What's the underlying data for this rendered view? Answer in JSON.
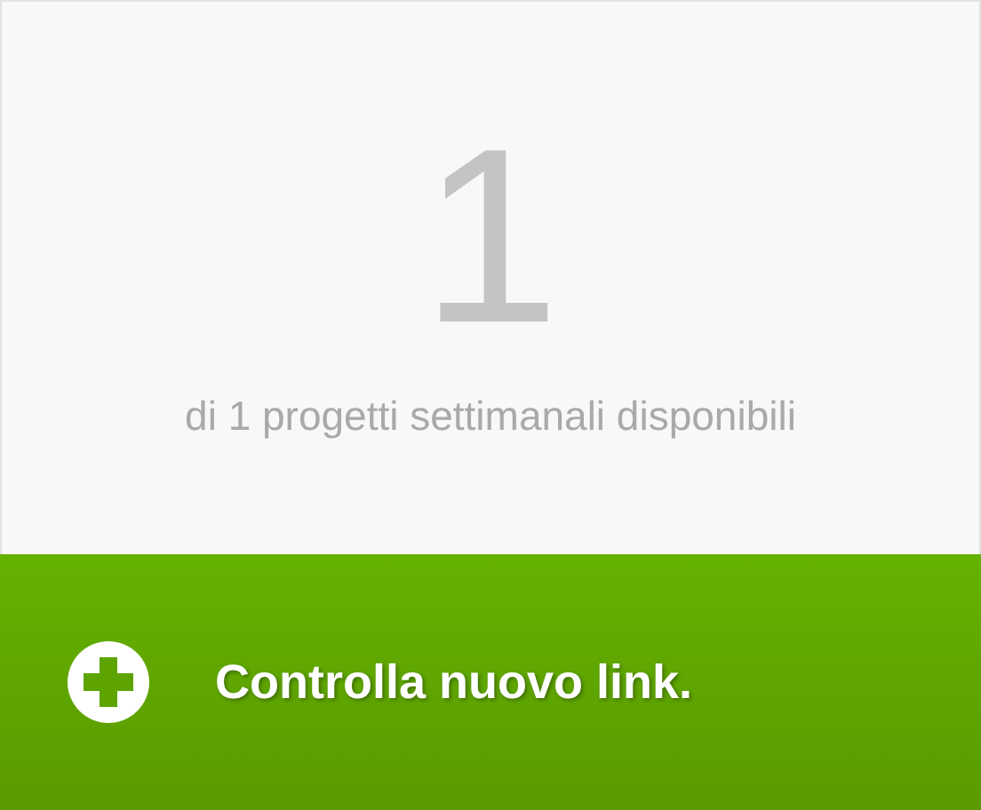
{
  "counter": {
    "value": "1",
    "caption": "di 1 progetti settimanali disponibili"
  },
  "action": {
    "label": "Controlla nuovo link."
  }
}
